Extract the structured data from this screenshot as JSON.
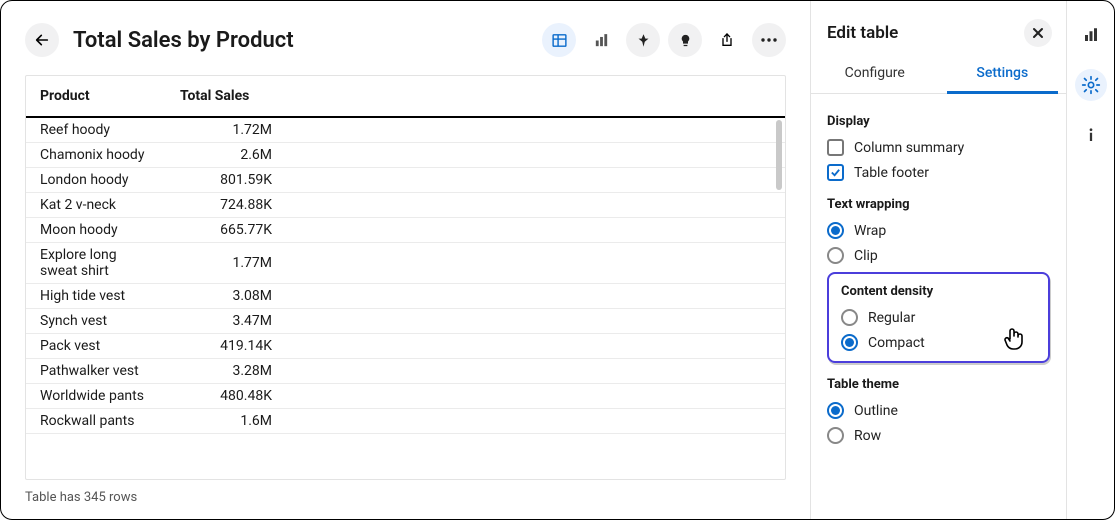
{
  "header": {
    "title": "Total Sales by Product"
  },
  "table": {
    "columns": [
      "Product",
      "Total Sales"
    ],
    "rows": [
      {
        "p": "Reef hoody",
        "s": "1.72M"
      },
      {
        "p": "Chamonix hoody",
        "s": "2.6M"
      },
      {
        "p": "London hoody",
        "s": "801.59K"
      },
      {
        "p": "Kat 2 v-neck",
        "s": "724.88K"
      },
      {
        "p": "Moon hoody",
        "s": "665.77K"
      },
      {
        "p": "Explore long sweat shirt",
        "s": "1.77M"
      },
      {
        "p": "High tide vest",
        "s": "3.08M"
      },
      {
        "p": "Synch vest",
        "s": "3.47M"
      },
      {
        "p": "Pack vest",
        "s": "419.14K"
      },
      {
        "p": "Pathwalker vest",
        "s": "3.28M"
      },
      {
        "p": "Worldwide pants",
        "s": "480.48K"
      },
      {
        "p": "Rockwall pants",
        "s": "1.6M"
      }
    ],
    "footer": "Table has 345 rows"
  },
  "side": {
    "title": "Edit table",
    "tabs": {
      "configure": "Configure",
      "settings": "Settings"
    },
    "display": {
      "heading": "Display",
      "column_summary": "Column summary",
      "table_footer": "Table footer"
    },
    "wrap": {
      "heading": "Text wrapping",
      "wrap": "Wrap",
      "clip": "Clip"
    },
    "density": {
      "heading": "Content density",
      "regular": "Regular",
      "compact": "Compact"
    },
    "theme": {
      "heading": "Table theme",
      "outline": "Outline",
      "row": "Row"
    }
  }
}
